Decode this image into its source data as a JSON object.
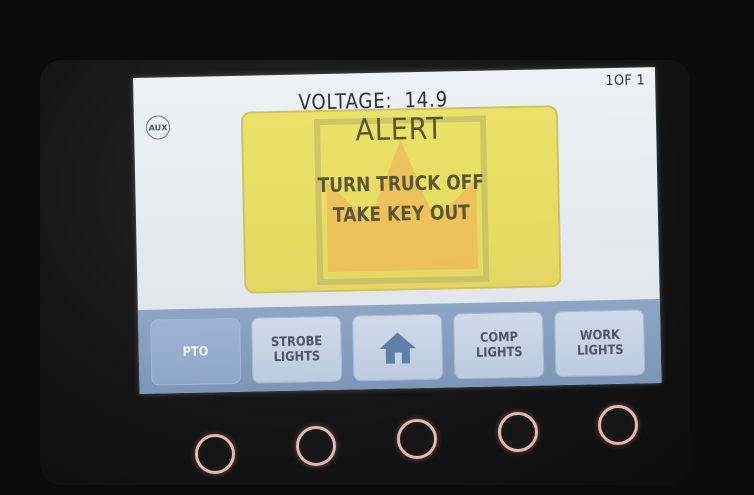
{
  "screen": {
    "voltage_label": "VOLTAGE:",
    "voltage_value": "14.9",
    "page_indicator": "1OF 1",
    "aux_label": "AUX"
  },
  "alert": {
    "title": "ALERT",
    "line1": "TURN TRUCK OFF",
    "line2": "TAKE KEY OUT",
    "icon": "crown-icon",
    "color": "#e8df66"
  },
  "buttons": [
    {
      "label": "PTO",
      "active": true
    },
    {
      "label_line1": "STROBE",
      "label_line2": "LIGHTS"
    },
    {
      "icon": "home-icon"
    },
    {
      "label_line1": "COMP",
      "label_line2": "LIGHTS"
    },
    {
      "label_line1": "WORK",
      "label_line2": "LIGHTS"
    }
  ],
  "hardware_buttons": [
    "button-1",
    "button-2",
    "button-3",
    "button-4",
    "button-5"
  ],
  "colors": {
    "screen_bg": "#e6eaf0",
    "button_bar": "#86a0c2",
    "button_face": "#c4d2e5",
    "active_button": "#95abcb",
    "ring_light": "#e3b8ad"
  }
}
